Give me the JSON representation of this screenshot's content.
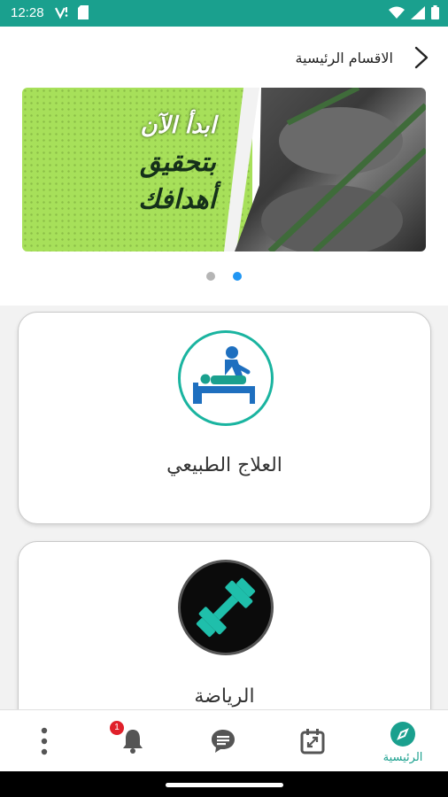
{
  "status_bar": {
    "time": "12:28",
    "icons": [
      "signal-icon",
      "sim-card-icon",
      "wifi-icon",
      "cellular-icon",
      "battery-icon"
    ]
  },
  "header": {
    "title": "الاقسام الرئيسية",
    "back_icon": "chevron-right-icon"
  },
  "banner": {
    "lines": [
      "ابدأ الآن",
      "بتحقيق",
      "أهدافك"
    ],
    "slide_count": 2,
    "active_slide": 2
  },
  "categories": [
    {
      "label": "العلاج الطبيعي",
      "icon": "physiotherapy-icon"
    },
    {
      "label": "الرياضة",
      "icon": "dumbbell-icon"
    }
  ],
  "bottom_nav": {
    "items": [
      {
        "icon": "more-vertical-icon"
      },
      {
        "icon": "bell-icon",
        "badge": "1"
      },
      {
        "icon": "chat-icon"
      },
      {
        "icon": "calendar-icon"
      },
      {
        "icon": "compass-icon",
        "label": "الرئيسية"
      }
    ]
  },
  "colors": {
    "primary": "#1aa08e",
    "status_bar": "#1aa08e",
    "banner_green": "#a7e05a",
    "active_dot": "#2196f3",
    "badge": "#e0202a"
  }
}
